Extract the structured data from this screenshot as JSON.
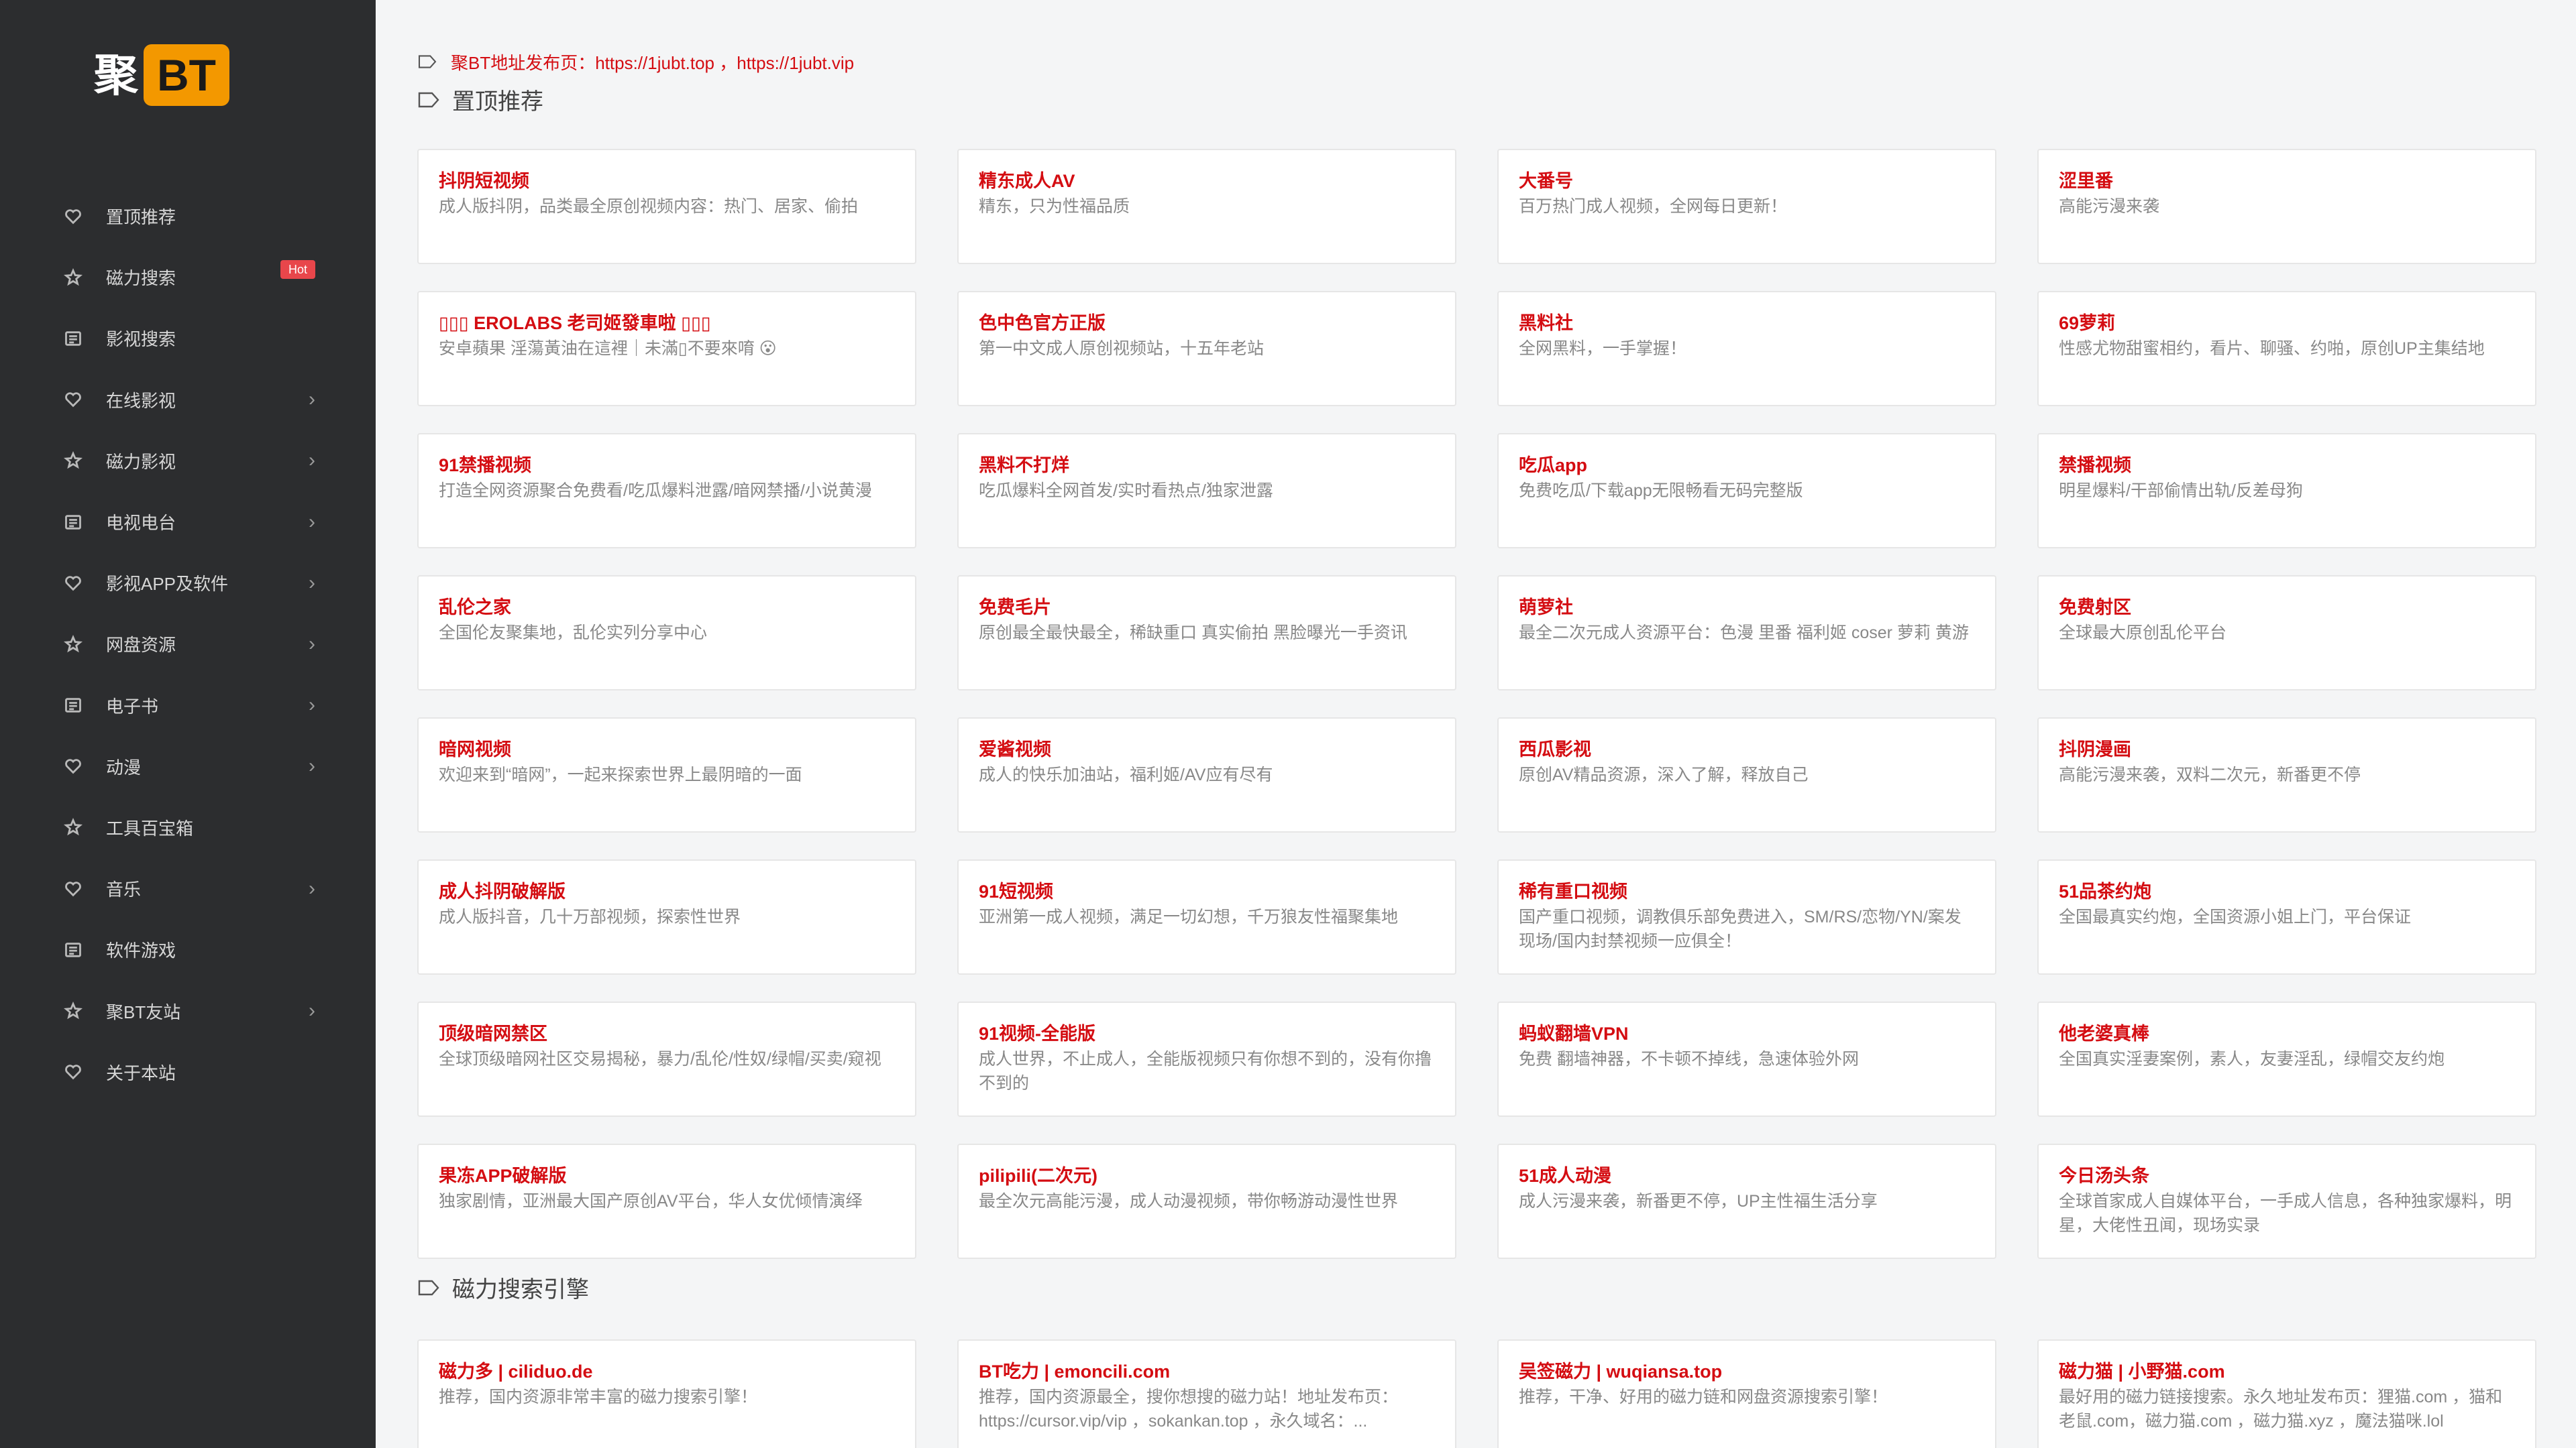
{
  "logo": {
    "ju": "聚",
    "bt": "BT"
  },
  "sidebar": {
    "items": [
      {
        "label": "置顶推荐",
        "icon": "heart-icon",
        "chevron": false,
        "badge": ""
      },
      {
        "label": "磁力搜索",
        "icon": "star-icon",
        "chevron": false,
        "badge": "Hot"
      },
      {
        "label": "影视搜索",
        "icon": "list-icon",
        "chevron": false,
        "badge": ""
      },
      {
        "label": "在线影视",
        "icon": "heart-icon",
        "chevron": true,
        "badge": ""
      },
      {
        "label": "磁力影视",
        "icon": "star-icon",
        "chevron": true,
        "badge": ""
      },
      {
        "label": "电视电台",
        "icon": "list-icon",
        "chevron": true,
        "badge": ""
      },
      {
        "label": "影视APP及软件",
        "icon": "heart-icon",
        "chevron": true,
        "badge": ""
      },
      {
        "label": "网盘资源",
        "icon": "star-icon",
        "chevron": true,
        "badge": ""
      },
      {
        "label": "电子书",
        "icon": "list-icon",
        "chevron": true,
        "badge": ""
      },
      {
        "label": "动漫",
        "icon": "heart-icon",
        "chevron": true,
        "badge": ""
      },
      {
        "label": "工具百宝箱",
        "icon": "star-icon",
        "chevron": false,
        "badge": ""
      },
      {
        "label": "音乐",
        "icon": "heart-icon",
        "chevron": true,
        "badge": ""
      },
      {
        "label": "软件游戏",
        "icon": "list-icon",
        "chevron": false,
        "badge": ""
      },
      {
        "label": "聚BT友站",
        "icon": "star-icon",
        "chevron": true,
        "badge": ""
      },
      {
        "label": "关于本站",
        "icon": "heart-icon",
        "chevron": false,
        "badge": ""
      }
    ]
  },
  "main": {
    "notice": "聚BT地址发布页：https://1jubt.top  ，https://1jubt.vip",
    "sections": [
      {
        "title": "置顶推荐",
        "cards": [
          {
            "title": "抖阴短视频",
            "desc": "成人版抖阴，品类最全原创视频内容：热门、居家、偷拍"
          },
          {
            "title": "精东成人AV",
            "desc": "精东，只为性福品质"
          },
          {
            "title": "大番号",
            "desc": "百万热门成人视频，全网每日更新！"
          },
          {
            "title": "涩里番",
            "desc": "高能污漫来袭"
          },
          {
            "title": "▯▯▯ EROLABS 老司姬發車啦 ▯▯▯",
            "desc": "安卓蘋果 淫蕩黃油在這裡｜未滿▯不要來唷 😮"
          },
          {
            "title": "色中色官方正版",
            "desc": "第一中文成人原创视频站，十五年老站"
          },
          {
            "title": "黑料社",
            "desc": "全网黑料，一手掌握！"
          },
          {
            "title": "69萝莉",
            "desc": "性感尤物甜蜜相约，看片、聊骚、约啪，原创UP主集结地"
          },
          {
            "title": "91禁播视频",
            "desc": "打造全网资源聚合免费看/吃瓜爆料泄露/暗网禁播/小说黄漫"
          },
          {
            "title": "黑料不打烊",
            "desc": "吃瓜爆料全网首发/实时看热点/独家泄露"
          },
          {
            "title": "吃瓜app",
            "desc": "免费吃瓜/下载app无限畅看无码完整版"
          },
          {
            "title": "禁播视频",
            "desc": "明星爆料/干部偷情出轨/反差母狗"
          },
          {
            "title": "乱伦之家",
            "desc": "全国伦友聚集地，乱伦实列分享中心"
          },
          {
            "title": "免费毛片",
            "desc": "原创最全最快最全，稀缺重口 真实偷拍 黑脸曝光一手资讯"
          },
          {
            "title": "萌萝社",
            "desc": "最全二次元成人资源平台：色漫 里番 福利姬 coser 萝莉 黄游"
          },
          {
            "title": "免费射区",
            "desc": "全球最大原创乱伦平台"
          },
          {
            "title": "暗网视频",
            "desc": "欢迎来到“暗网”，一起来探索世界上最阴暗的一面"
          },
          {
            "title": "爱酱视频",
            "desc": "成人的快乐加油站，福利姬/AV应有尽有"
          },
          {
            "title": "西瓜影视",
            "desc": "原创AV精品资源，深入了解，释放自己"
          },
          {
            "title": "抖阴漫画",
            "desc": "高能污漫来袭，双料二次元，新番更不停"
          },
          {
            "title": "成人抖阴破解版",
            "desc": "成人版抖音，几十万部视频，探索性世界"
          },
          {
            "title": "91短视频",
            "desc": "亚洲第一成人视频，满足一切幻想，千万狼友性福聚集地"
          },
          {
            "title": "稀有重口视频",
            "desc": "国产重口视频，调教俱乐部免费进入，SM/RS/恋物/YN/案发现场/国内封禁视频一应俱全！"
          },
          {
            "title": "51品茶约炮",
            "desc": "全国最真实约炮，全国资源小姐上门，平台保证"
          },
          {
            "title": "顶级暗网禁区",
            "desc": "全球顶级暗网社区交易揭秘，暴力/乱伦/性奴/绿帽/买卖/窥视"
          },
          {
            "title": "91视频-全能版",
            "desc": "成人世界，不止成人，全能版视频只有你想不到的，没有你撸不到的"
          },
          {
            "title": "蚂蚁翻墙VPN",
            "desc": "免费 翻墙神器，不卡顿不掉线，急速体验外网"
          },
          {
            "title": "他老婆真棒",
            "desc": "全国真实淫妻案例，素人，友妻淫乱，绿帽交友约炮"
          },
          {
            "title": "果冻APP破解版",
            "desc": "独家剧情，亚洲最大国产原创AV平台，华人女优倾情演绎"
          },
          {
            "title": "pilipili(二次元)",
            "desc": "最全次元高能污漫，成人动漫视频，带你畅游动漫性世界"
          },
          {
            "title": "51成人动漫",
            "desc": "成人污漫来袭，新番更不停，UP主性福生活分享"
          },
          {
            "title": "今日汤头条",
            "desc": "全球首家成人自媒体平台，一手成人信息，各种独家爆料，明星，大佬性丑闻，现场实录"
          }
        ]
      },
      {
        "title": "磁力搜索引擎",
        "cards": [
          {
            "title": "磁力多 | ciliduo.de",
            "desc": "推荐，国内资源非常丰富的磁力搜索引擎！"
          },
          {
            "title": "BT吃力 | emoncili.com",
            "desc": "推荐，国内资源最全，搜你想搜的磁力站！地址发布页：https://cursor.vip/vip ，sokankan.top ，永久域名：..."
          },
          {
            "title": "吴签磁力 | wuqiansa.top",
            "desc": "推荐，干净、好用的磁力链和网盘资源搜索引擎！"
          },
          {
            "title": "磁力猫 | 小野猫.com",
            "desc": "最好用的磁力链接搜索。永久地址发布页：狸猫.com ，猫和老鼠.com，磁力猫.com ，磁力猫.xyz ，魔法猫咪.lol"
          }
        ]
      }
    ]
  }
}
